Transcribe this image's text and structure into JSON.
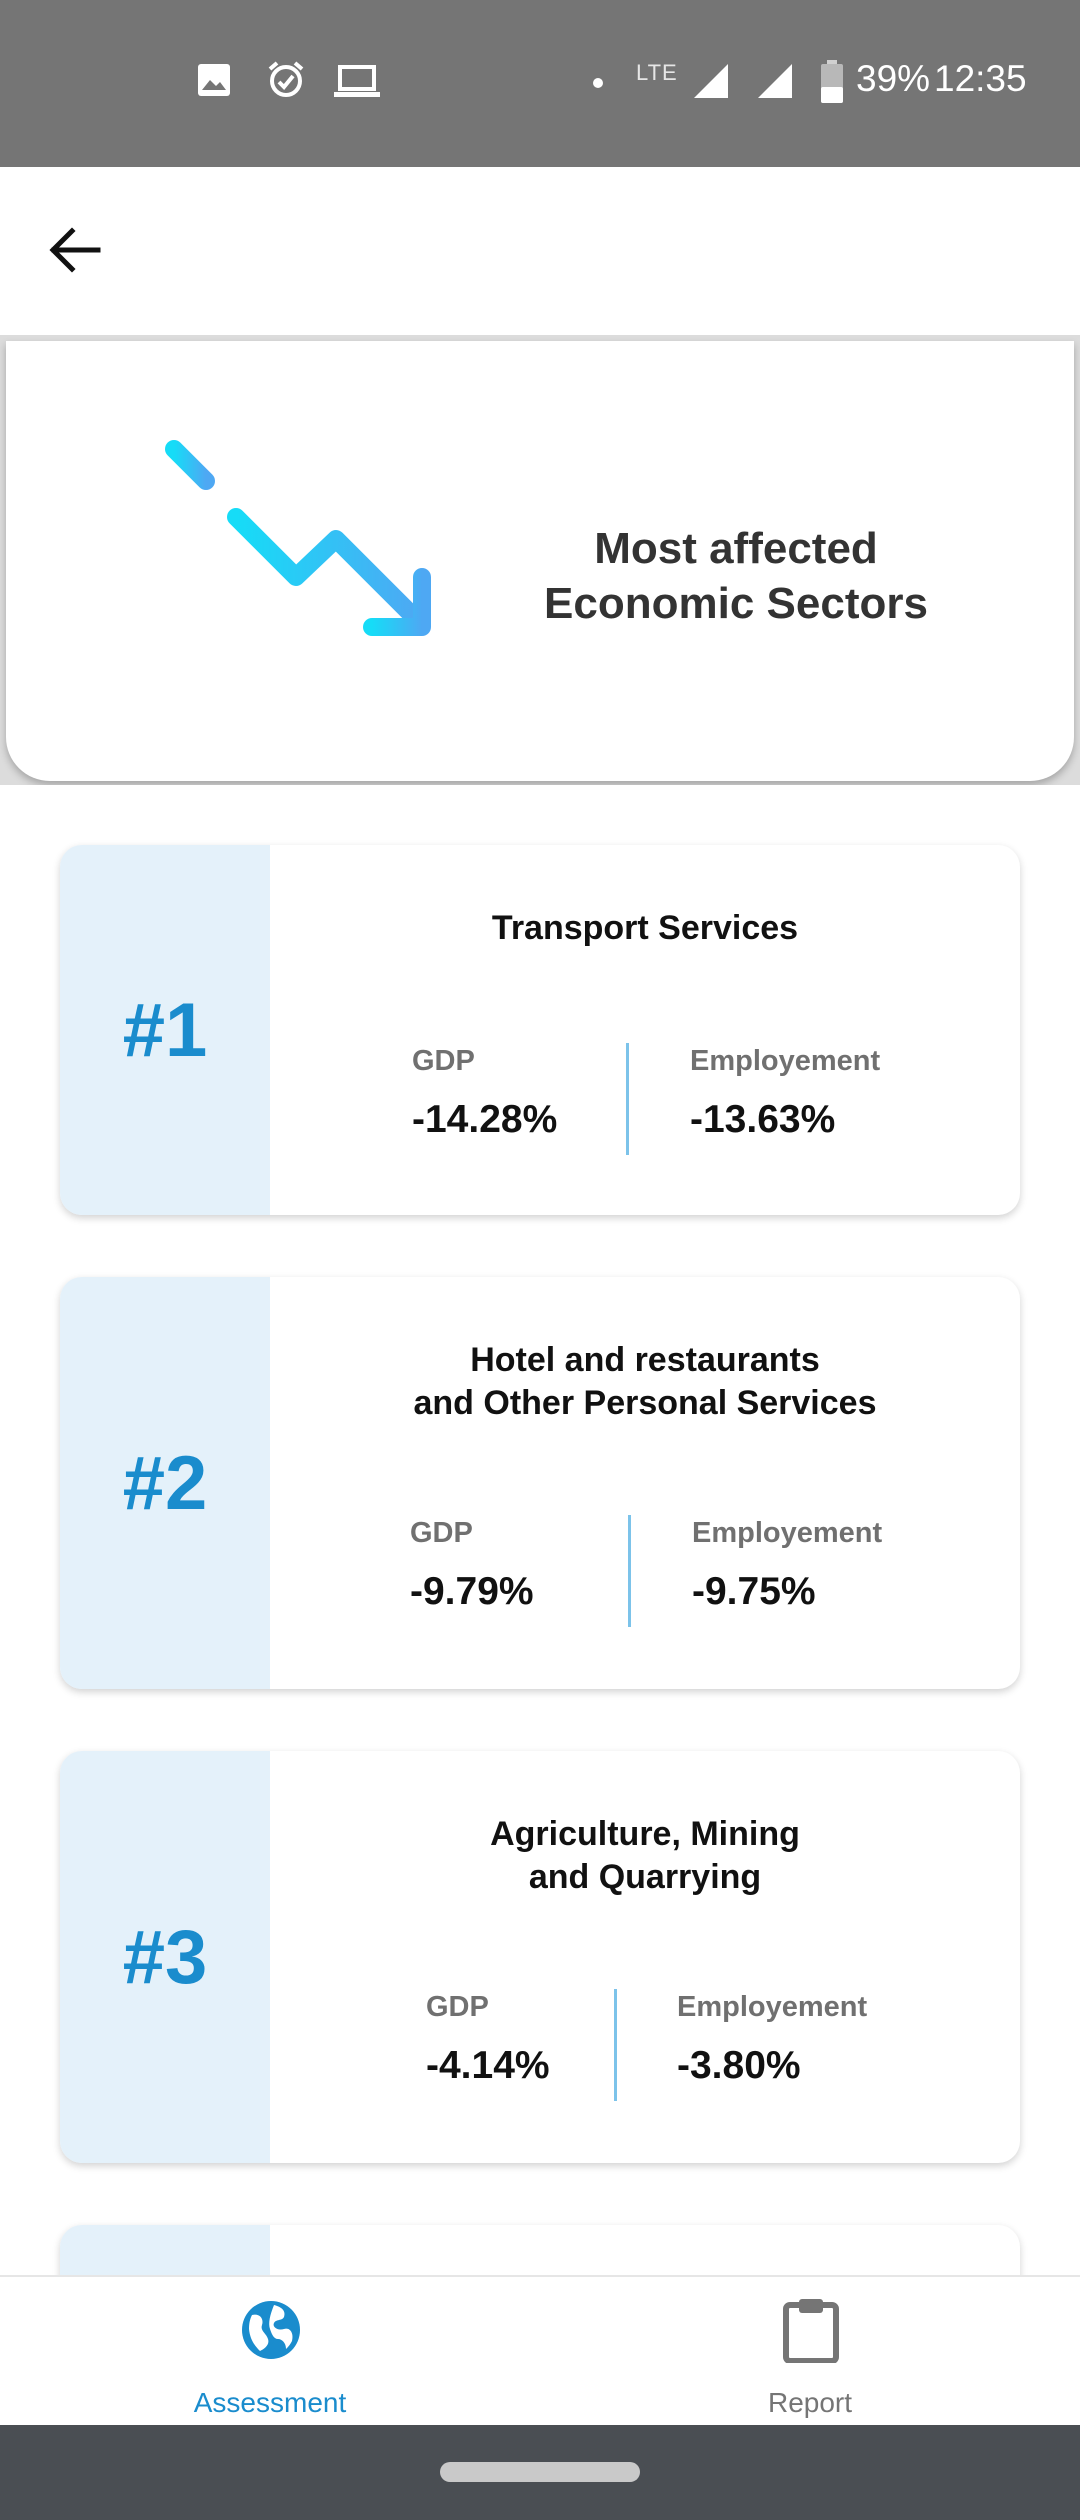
{
  "status_bar": {
    "network": "LTE",
    "battery": "39%",
    "time": "12:35",
    "icons": [
      "image-icon",
      "alarm-icon",
      "laptop-icon",
      "dot-icon",
      "signal-icon",
      "signal-icon",
      "battery-icon"
    ]
  },
  "app_bar": {
    "back_icon": "arrow-left-icon"
  },
  "header": {
    "icon": "chart-decline-icon",
    "title_line1": "Most affected",
    "title_line2": "Economic Sectors"
  },
  "colors": {
    "accent": "#1a8ccd",
    "rank_panel": "#e4f1fa",
    "divider": "#7cc3ea",
    "status_bar": "#757575",
    "nav_inactive": "#757575"
  },
  "sectors": [
    {
      "rank": "#1",
      "name_line1": "Transport Services",
      "name_line2": "",
      "gdp_label": "GDP",
      "gdp_value": "-14.28%",
      "emp_label": "Employement",
      "emp_value": "-13.63%"
    },
    {
      "rank": "#2",
      "name_line1": "Hotel and restaurants",
      "name_line2": "and Other Personal Services",
      "gdp_label": "GDP",
      "gdp_value": "-9.79%",
      "emp_label": "Employement",
      "emp_value": "-9.75%"
    },
    {
      "rank": "#3",
      "name_line1": "Agriculture, Mining",
      "name_line2": "and Quarrying",
      "gdp_label": "GDP",
      "gdp_value": "-4.14%",
      "emp_label": "Employement",
      "emp_value": "-3.80%"
    }
  ],
  "bottom_nav": {
    "items": [
      {
        "label": "Assessment",
        "icon": "globe-icon",
        "active": true
      },
      {
        "label": "Report",
        "icon": "clipboard-icon",
        "active": false
      }
    ]
  }
}
